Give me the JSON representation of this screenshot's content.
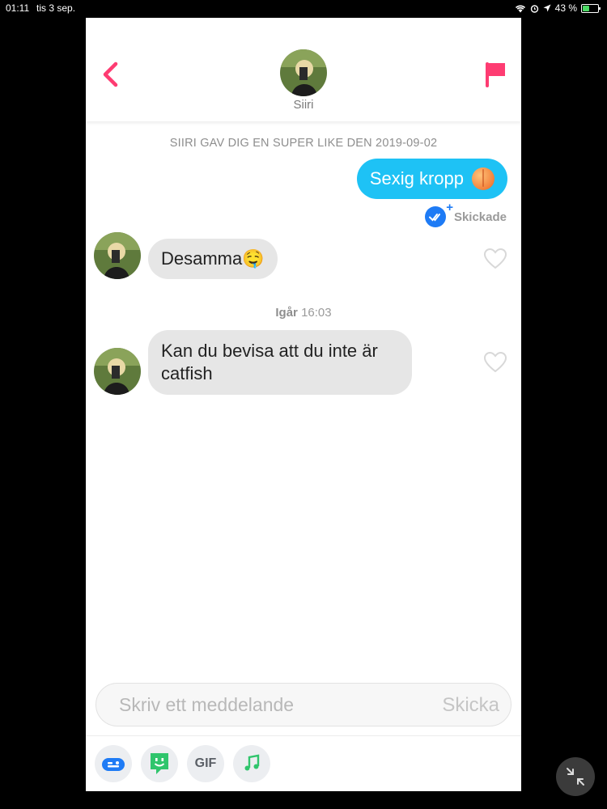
{
  "status_bar": {
    "time": "01:11",
    "date": "tis 3 sep.",
    "battery": "43 %"
  },
  "header": {
    "match_name": "Siiri",
    "back_icon": "chevron-left-icon",
    "report_icon": "flag-icon"
  },
  "conversation": {
    "super_like_notice": "SIIRI GAV DIG EN SUPER LIKE DEN 2019-09-02",
    "outgoing": {
      "text": "Sexig kropp",
      "emoji_icon": "peach-icon",
      "status": "Skickade"
    },
    "incoming_1": {
      "text": "Desamma🤤"
    },
    "time_divider": {
      "day": "Igår",
      "time": "16:03"
    },
    "incoming_2": {
      "text": "Kan du bevisa att du inte är catfish"
    }
  },
  "composer": {
    "placeholder": "Skriv ett meddelande",
    "send_label": "Skicka"
  },
  "toolbar": {
    "gif_label": "GIF",
    "tools": [
      "message-card-icon",
      "sticker-icon",
      "gif-icon",
      "music-note-icon"
    ]
  },
  "colors": {
    "accent": "#fe3c72",
    "outgoing_bubble": "#1ec2f5",
    "incoming_bubble": "#e6e6e6",
    "read_receipt": "#1e7bf5"
  }
}
